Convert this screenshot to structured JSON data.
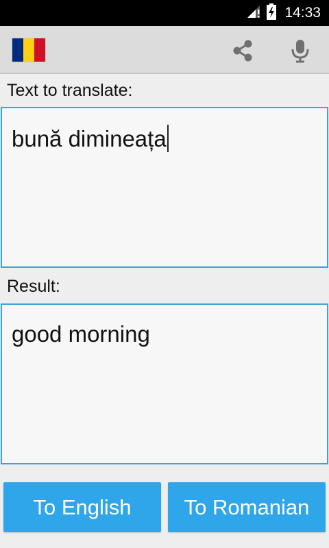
{
  "status_bar": {
    "time": "14:33",
    "signal_icon": "signal-icon",
    "battery_icon": "battery-charging-icon"
  },
  "toolbar": {
    "flag": "romania-flag",
    "flag_colors": [
      "#002b7f",
      "#fcd116",
      "#ce1126"
    ],
    "share_icon": "share-icon",
    "mic_icon": "microphone-icon"
  },
  "input_section": {
    "label": "Text to translate:",
    "value": "bună dimineața"
  },
  "result_section": {
    "label": "Result:",
    "value": "good morning"
  },
  "buttons": {
    "to_english": "To English",
    "to_romanian": "To Romanian"
  },
  "colors": {
    "accent": "#2fa6ea",
    "field_border": "#3aa3dd"
  }
}
